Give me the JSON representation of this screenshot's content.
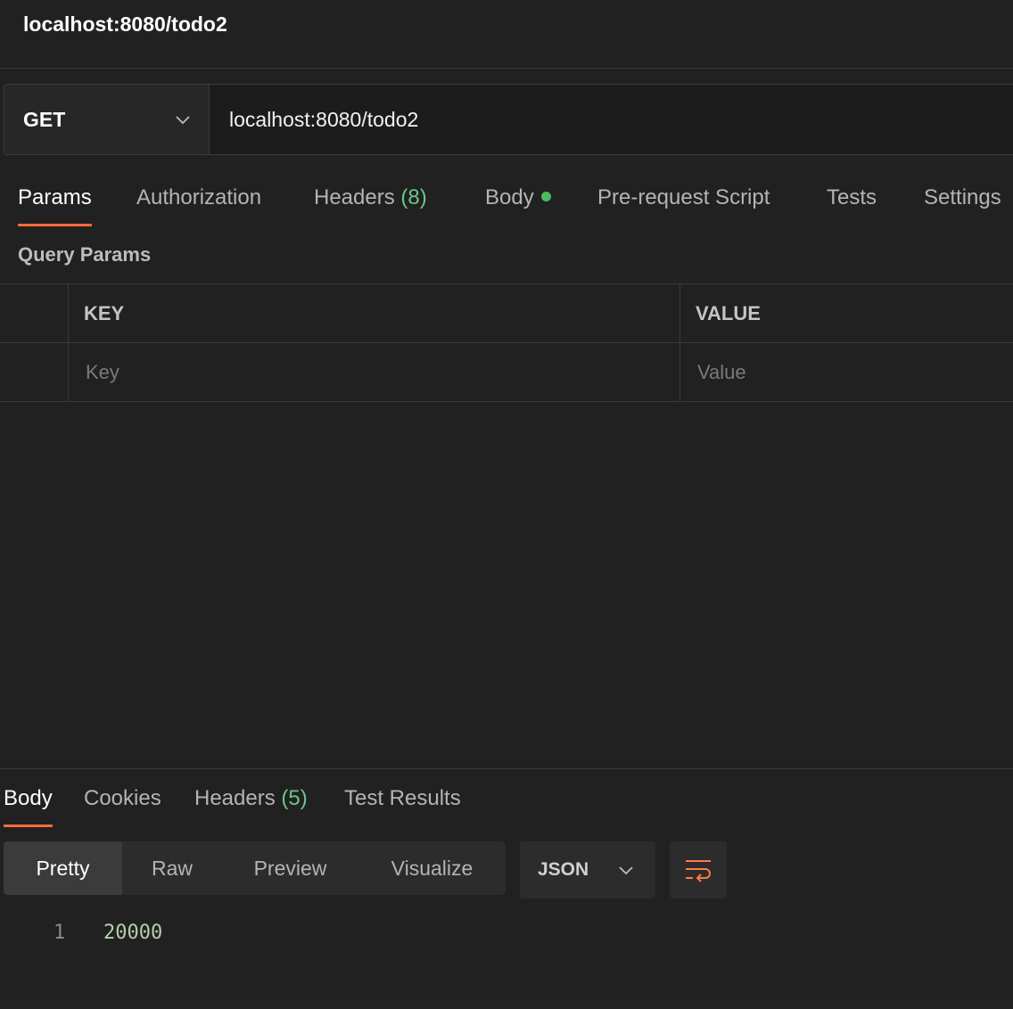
{
  "request": {
    "title": "localhost:8080/todo2",
    "method": "GET",
    "url": "localhost:8080/todo2"
  },
  "request_tabs": {
    "params": "Params",
    "authorization": "Authorization",
    "headers": "Headers",
    "headers_count": "(8)",
    "body": "Body",
    "pre_request_script": "Pre-request Script",
    "tests": "Tests",
    "settings": "Settings",
    "active": "Params"
  },
  "query_params": {
    "section_label": "Query Params",
    "columns": [
      "KEY",
      "VALUE"
    ],
    "key_placeholder": "Key",
    "value_placeholder": "Value"
  },
  "response_tabs": {
    "body": "Body",
    "cookies": "Cookies",
    "headers": "Headers",
    "headers_count": "(5)",
    "test_results": "Test Results",
    "active": "Body"
  },
  "format_tabs": {
    "items": [
      "Pretty",
      "Raw",
      "Preview",
      "Visualize"
    ],
    "active": "Pretty"
  },
  "language_select": {
    "value": "JSON"
  },
  "response_body": {
    "lines": [
      {
        "number": "1",
        "text": "20000"
      }
    ]
  },
  "colors": {
    "accent": "#ff6c37",
    "count_green": "#6cc588",
    "body_dot": "#4cbb5b",
    "background": "#212121"
  },
  "icons": [
    "chevron-down-icon",
    "wrap-lines-icon"
  ]
}
